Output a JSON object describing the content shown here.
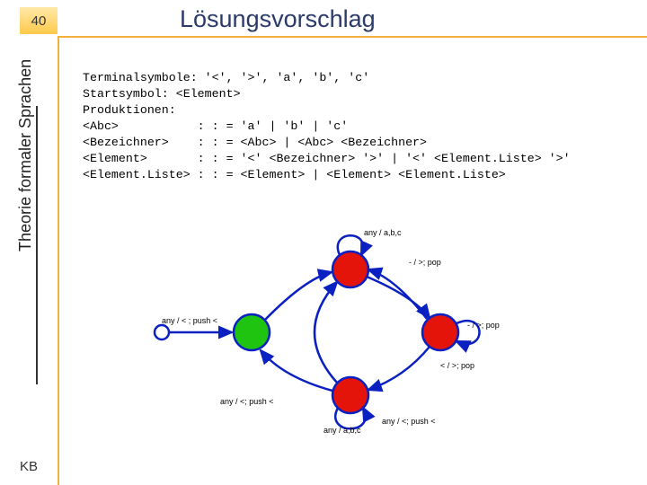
{
  "page_number": "40",
  "title": "Lösungsvorschlag",
  "side_label": "Theorie formaler Sprachen",
  "footer": "KB",
  "grammar": {
    "line1": "Terminalsymbole: '<', '>', 'a', 'b', 'c'",
    "line2": "Startsymbol: <Element>",
    "line3": "Produktionen:",
    "line4": "<Abc>           : : = 'a' | 'b' | 'c'",
    "line5": "<Bezeichner>    : : = <Abc> | <Abc> <Bezeichner>",
    "line6": "<Element>       : : = '<' <Bezeichner> '>' | '<' <Element.Liste> '>'",
    "line7": "<Element.Liste> : : = <Element> | <Element> <Element.Liste>"
  },
  "diagram": {
    "labels": {
      "top_self": "any / a,b,c",
      "top_right": "- / >; pop",
      "left_in": "any / < ; push <",
      "right_self": "- / >; pop",
      "right_down": "< / >; pop",
      "bottom_left": "any / <; push <",
      "bottom_mid": "any / a,b,c",
      "bottom_right": "any / <; push <"
    }
  }
}
